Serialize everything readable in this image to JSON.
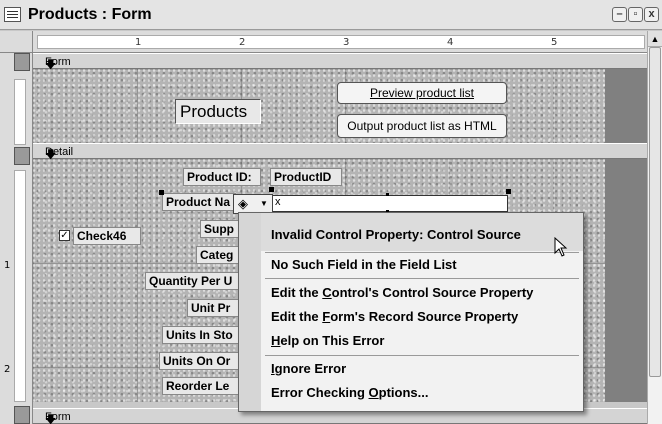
{
  "window": {
    "title": "Products : Form",
    "controls": [
      "–",
      "▫",
      "x"
    ]
  },
  "ruler": {
    "h_numbers": [
      "1",
      "2",
      "3",
      "4",
      "5"
    ],
    "v_numbers": [
      "1",
      "2"
    ]
  },
  "sections": {
    "header": "Form Header",
    "detail": "Detail",
    "footer": "Form Footer"
  },
  "header_controls": {
    "title_label": "Products",
    "preview_button": "Preview product list",
    "output_button": "Output product list as HTML"
  },
  "detail_controls": {
    "product_id_label": "Product ID:",
    "product_id_field": "ProductID",
    "product_name_label": "Product Na",
    "check_label": "Check46",
    "supplier_label": "Supp",
    "category_label": "Categ",
    "quantity_label": "Quantity Per U",
    "unit_price_label": "Unit Pr",
    "units_in_stock_label": "Units In Sto",
    "units_on_order_label": "Units On Or",
    "reorder_label": "Reorder Le",
    "textbox_value": "x",
    "checkbox_checked": true
  },
  "context_menu": {
    "items": [
      {
        "text": "Invalid Control Property: Control Source",
        "highlighted": true
      },
      {
        "text": "No Such Field in the Field List",
        "highlighted": true
      },
      {
        "pre": "Edit the ",
        "ul": "C",
        "post": "ontrol's Control Source Property"
      },
      {
        "pre": "Edit the ",
        "ul": "F",
        "post": "orm's Record Source Property"
      },
      {
        "pre": "",
        "ul": "H",
        "post": "elp on This Error"
      },
      {
        "pre": "",
        "ul": "I",
        "post": "gnore Error"
      },
      {
        "pre": "Error Checking ",
        "ul": "O",
        "post": "ptions..."
      }
    ]
  },
  "error_smart_tag": {
    "icon": "warning-diamond-icon",
    "arrow": "chevron-down-icon"
  }
}
